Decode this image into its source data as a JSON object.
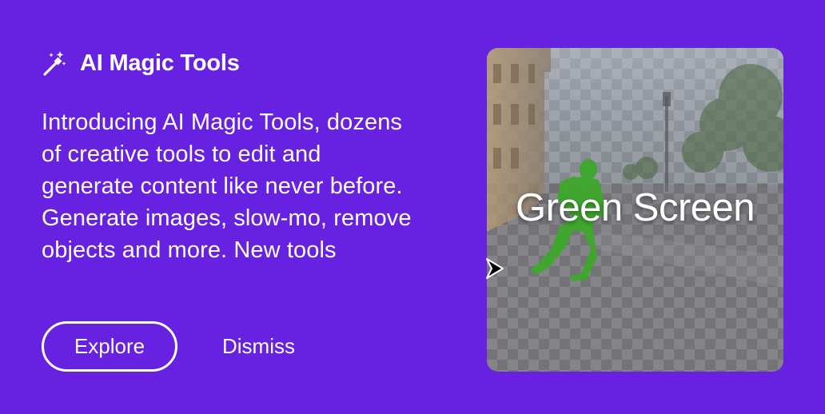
{
  "card": {
    "title": "AI Magic Tools",
    "title_icon": "magic-wand-icon",
    "description": "Introducing AI Magic Tools, dozens of creative tools to edit and generate content like never before. Generate images, slow-mo, remove objects and more. New tools",
    "explore_label": "Explore",
    "dismiss_label": "Dismiss"
  },
  "preview": {
    "label": "Green Screen",
    "overlay_icon": "pointer-arrow-icon"
  },
  "colors": {
    "background": "#6721e0",
    "text": "#ffffff",
    "subject_mask": "#3ea82c"
  }
}
